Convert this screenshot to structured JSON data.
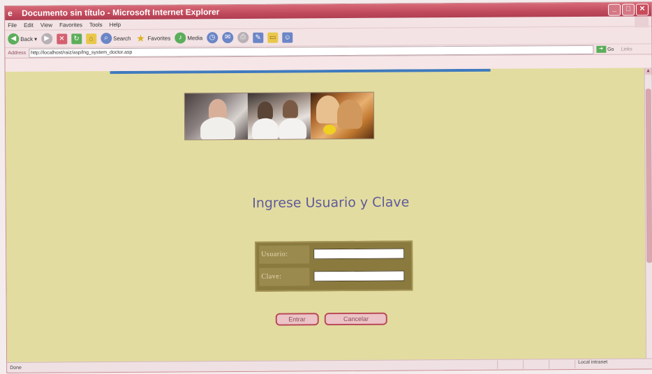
{
  "window": {
    "title": "Documento sin título - Microsoft Internet Explorer",
    "controls": {
      "minimize": "_",
      "maximize": "□",
      "close": "✕"
    }
  },
  "menu": [
    "File",
    "Edit",
    "View",
    "Favorites",
    "Tools",
    "Help"
  ],
  "toolbar": {
    "back_label": "Back",
    "search_label": "Search",
    "favorites_label": "Favorites",
    "media_label": "Media"
  },
  "address": {
    "label": "Address",
    "url": "http://localhost/raiz/asp/lng_system_doctor.asp",
    "go_label": "Go",
    "links_label": "Links"
  },
  "page": {
    "heading": "Ingrese Usuario y Clave",
    "user_label": "Usuario:",
    "password_label": "Clave:",
    "user_value": "",
    "password_value": "",
    "enter_button": "Entrar",
    "cancel_button": "Cancelar"
  },
  "status": {
    "text": "Done",
    "zone": "Local intranet"
  },
  "colors": {
    "page_background": "#e3dca0",
    "heading": "#5d5a9a",
    "login_box": "#8a7a3e",
    "titlebar": "#c04a5c"
  }
}
